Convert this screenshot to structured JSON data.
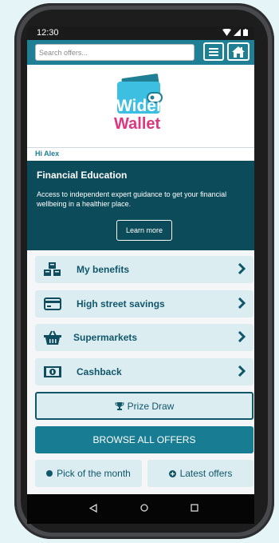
{
  "status": {
    "time": "12:30"
  },
  "search": {
    "placeholder": "Search offers..."
  },
  "brand": {
    "line1": "Wider",
    "line2": "Wallet",
    "teal": "#1e7f95",
    "pink": "#e0357f"
  },
  "greeting": "Hi Alex",
  "education": {
    "title": "Financial Education",
    "description": "Access to independent expert guidance to get your financial wellbeing in a healthier place.",
    "button": "Learn more"
  },
  "menu": [
    {
      "label": "My benefits",
      "icon": "boxes-icon"
    },
    {
      "label": "High street savings",
      "icon": "credit-card-icon"
    },
    {
      "label": "Supermarkets",
      "icon": "shopping-basket-icon"
    },
    {
      "label": "Cashback",
      "icon": "banknote-icon"
    }
  ],
  "prize_draw": "Prize Draw",
  "browse_all": "BROWSE ALL OFFERS",
  "pills": {
    "pick": "Pick of the month",
    "latest": "Latest offers"
  }
}
